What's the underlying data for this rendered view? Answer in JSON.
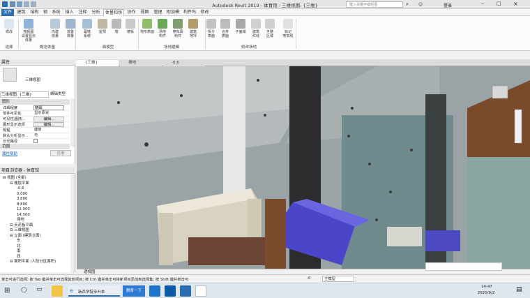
{
  "window": {
    "title": "Autodesk Revit 2019 -  体育馆 - 三维视图: {三维}",
    "search_placeholder": "键入关键字或短语",
    "login": "登录"
  },
  "menu": {
    "tabs": [
      "文件",
      "建筑",
      "结构",
      "钢",
      "系统",
      "插入",
      "注释",
      "分析",
      "体量和场地",
      "协作",
      "视图",
      "管理",
      "附加模块",
      "构件坞",
      "修改"
    ],
    "active_tab": "体量和场地"
  },
  "ribbon": {
    "buttons": [
      {
        "label": "修改",
        "icon": "cursor-icon"
      },
      {
        "label": "按视图\n设置显示体量",
        "icon": "massing-display-icon"
      },
      {
        "label": "内建\n体量",
        "icon": "inplace-mass-icon"
      },
      {
        "label": "放置\n体量",
        "icon": "place-mass-icon"
      },
      {
        "label": "幕墙\n系统",
        "icon": "curtain-system-icon"
      },
      {
        "label": "屋顶",
        "icon": "roof-icon"
      },
      {
        "label": "墙",
        "icon": "wall-icon"
      },
      {
        "label": "楼板",
        "icon": "floor-icon"
      },
      {
        "label": "地形表面",
        "icon": "toposurface-icon"
      },
      {
        "label": "场地\n构件",
        "icon": "site-component-icon"
      },
      {
        "label": "停车场\n构件",
        "icon": "parking-component-icon"
      },
      {
        "label": "建筑\n地坪",
        "icon": "building-pad-icon"
      },
      {
        "label": "拆分\n表面",
        "icon": "split-surface-icon"
      },
      {
        "label": "合并\n表面",
        "icon": "merge-surface-icon"
      },
      {
        "label": "子面域",
        "icon": "subregion-icon"
      },
      {
        "label": "建筑\n红线",
        "icon": "property-line-icon"
      },
      {
        "label": "平整\n区域",
        "icon": "graded-region-icon"
      },
      {
        "label": "标记\n等高线",
        "icon": "label-contours-icon"
      }
    ],
    "panels": [
      "选择",
      "概念体量",
      "面模型",
      "场地建模",
      "修改场地"
    ]
  },
  "properties": {
    "header": "属性",
    "type_name": "三维视图",
    "view_selector": "三维视图: {三维}",
    "edit_type": "编辑类型",
    "group": "图形",
    "rows": [
      {
        "k": "详细程度",
        "v": "精细"
      },
      {
        "k": "零件可见性",
        "v": "显示原状"
      },
      {
        "k": "可见性/图形...",
        "v": "编辑..."
      },
      {
        "k": "图形显示选项",
        "v": "编辑..."
      },
      {
        "k": "规程",
        "v": "建筑"
      },
      {
        "k": "默认分析显示...",
        "v": "无"
      },
      {
        "k": "日光路径",
        "v": ""
      }
    ],
    "group2": "范围",
    "help_link": "属性帮助",
    "apply": "应用"
  },
  "browser": {
    "header": "项目浏览器 - 体育馆",
    "nodes": [
      {
        "t": "视图 (全部)",
        "lvl": 0
      },
      {
        "t": "楼层平面",
        "lvl": 1
      },
      {
        "t": "-0.6",
        "lvl": 2
      },
      {
        "t": "0.000",
        "lvl": 2
      },
      {
        "t": "3.800",
        "lvl": 2
      },
      {
        "t": "8.800",
        "lvl": 2
      },
      {
        "t": "12.000",
        "lvl": 2
      },
      {
        "t": "14.500",
        "lvl": 2
      },
      {
        "t": "场地",
        "lvl": 2
      },
      {
        "t": "天花板平面",
        "lvl": 1
      },
      {
        "t": "三维视图",
        "lvl": 1
      },
      {
        "t": "立面 (建筑立面)",
        "lvl": 1
      },
      {
        "t": "东",
        "lvl": 2
      },
      {
        "t": "北",
        "lvl": 2
      },
      {
        "t": "南",
        "lvl": 2
      },
      {
        "t": "西",
        "lvl": 2
      },
      {
        "t": "面积平面 (人防分区面积)",
        "lvl": 1
      }
    ]
  },
  "view_tabs": [
    {
      "label": "{三维}",
      "active": true
    },
    {
      "label": "场地",
      "active": false
    },
    {
      "label": "-0.6",
      "active": false
    }
  ],
  "view_control": {
    "scale": "透视图"
  },
  "status": {
    "message": "单击可进行选择; 按 Tab 键并单击可选择其他项目; 按 Ctrl 键并单击可将新项目添加到选择集; 按 Shift 键并单击可",
    "zero": ":0",
    "model": "主模型"
  },
  "taskbar": {
    "items": [
      "新杀学院专升本",
      "教育一下"
    ],
    "time": "14:47",
    "date": "2020/9/2"
  },
  "colors": {
    "accent": "#2a6db0",
    "sofa_blue": "#4b46c9",
    "glass": "#7fa3a6"
  }
}
